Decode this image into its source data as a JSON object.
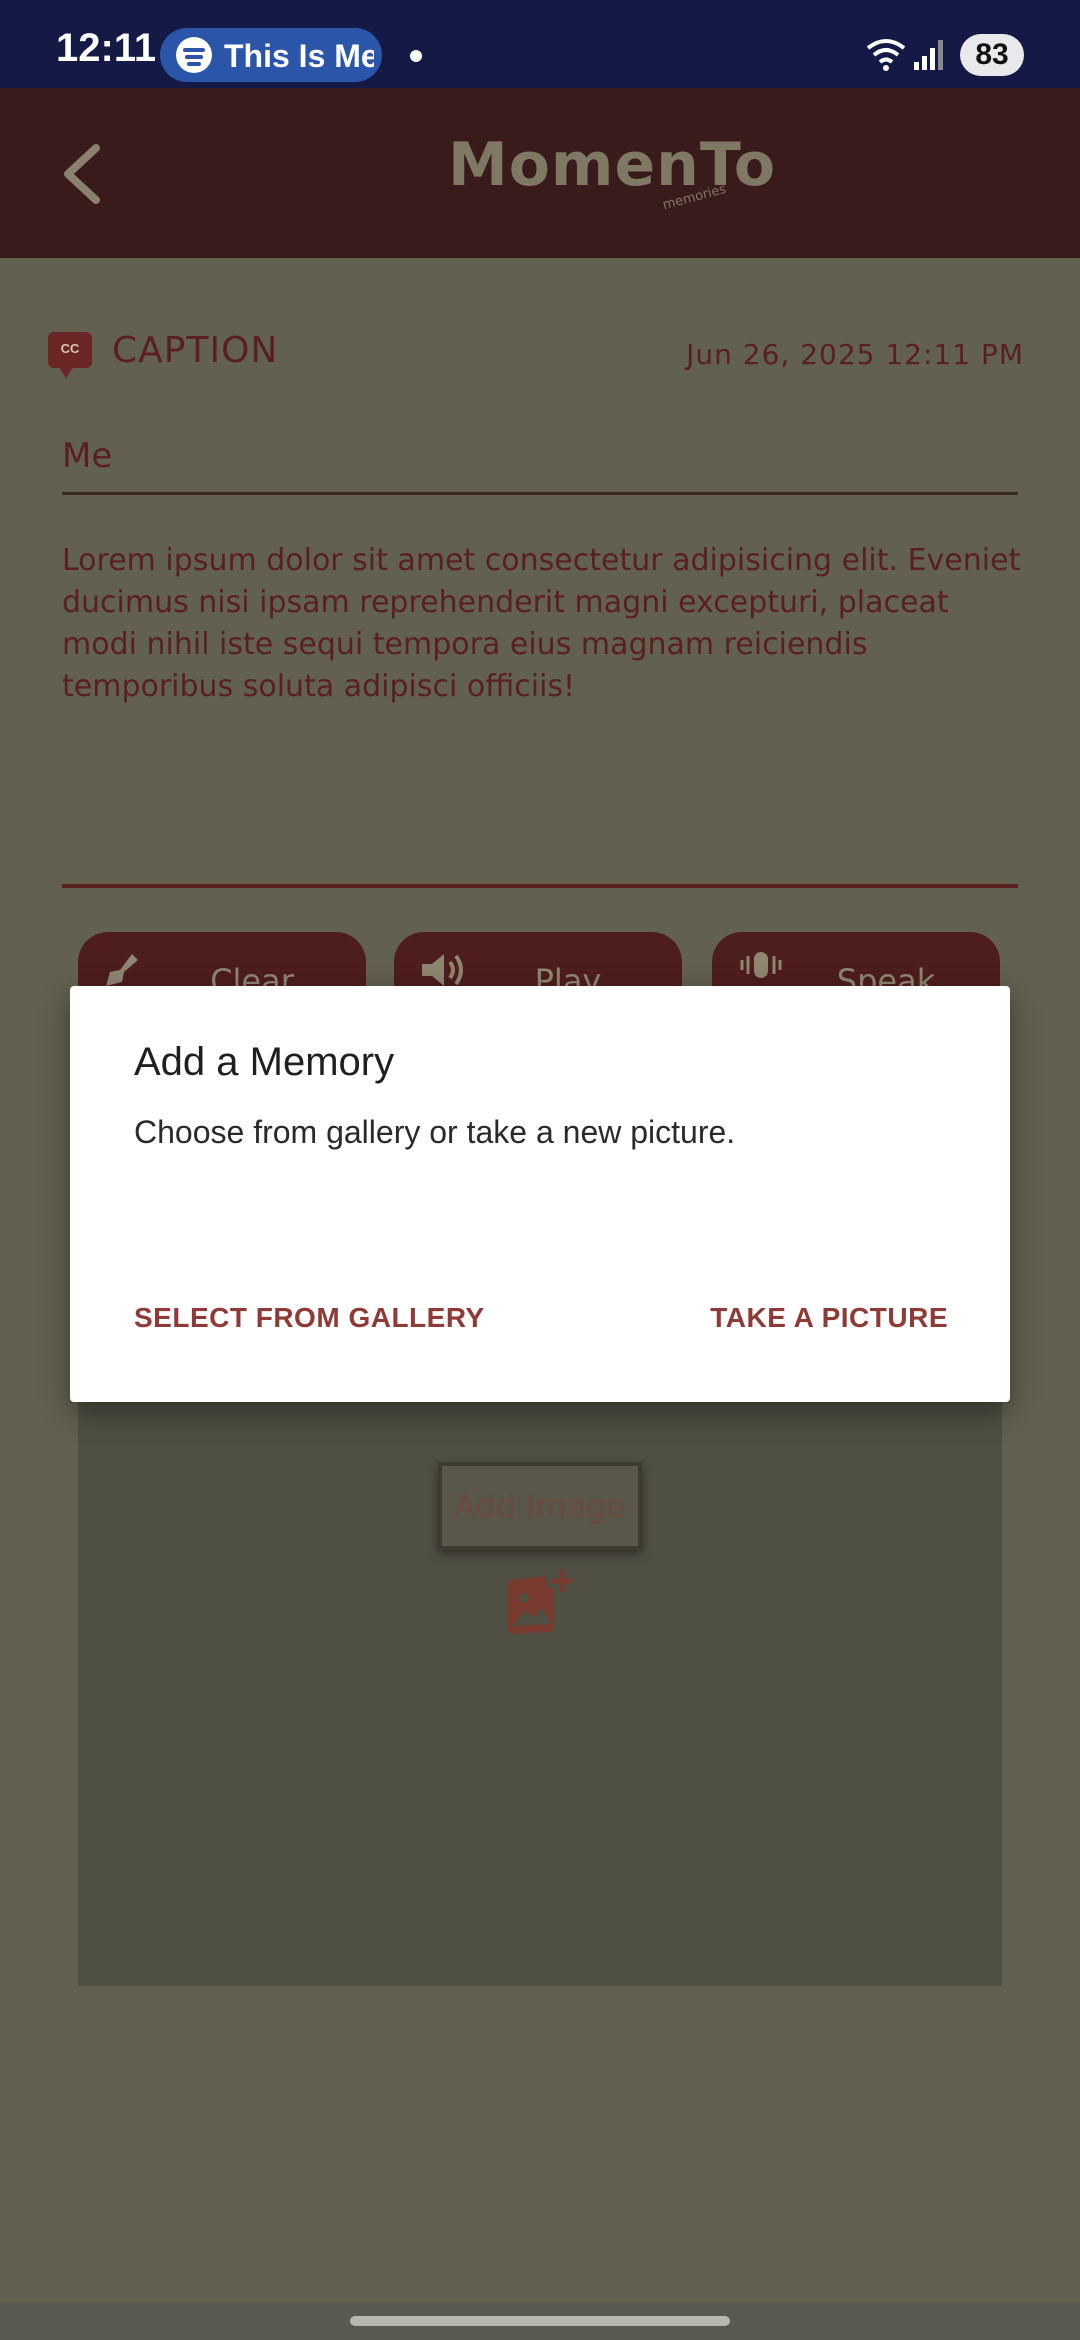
{
  "status_bar": {
    "time": "12:11",
    "media_pill_text": "This Is Me",
    "battery": "83",
    "icons": [
      "spotify-icon",
      "wifi-icon",
      "signal-icon",
      "battery-icon"
    ]
  },
  "app_bar": {
    "logo_text": "MomenTo",
    "logo_subtext": "memories",
    "back_icon": "chevron-left-icon"
  },
  "caption": {
    "icon_text": "CC",
    "label": "CAPTION",
    "date": "Jun 26, 2025 12:11 PM"
  },
  "memory": {
    "title_value": "Me",
    "body": "Lorem ipsum dolor sit amet consectetur adipisicing elit. Eveniet ducimus nisi ipsam reprehenderit magni excepturi, placeat modi nihil iste sequi tempora eius magnam reiciendis temporibus soluta adipisci officiis!"
  },
  "actions": {
    "clear": "Clear",
    "play": "Play",
    "speak": "Speak"
  },
  "image_area": {
    "add_image_label": "Add Image"
  },
  "dialog": {
    "title": "Add a Memory",
    "message": "Choose from gallery or take a new picture.",
    "gallery_button": "SELECT FROM GALLERY",
    "picture_button": "TAKE A PICTURE"
  },
  "colors": {
    "status_bar": "#141a45",
    "app_bar": "#3a1b1b",
    "accent": "#8f3a36",
    "scrim_background": "#62604f"
  }
}
